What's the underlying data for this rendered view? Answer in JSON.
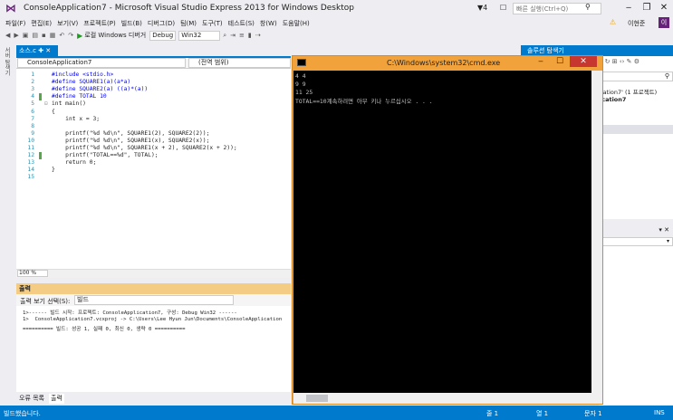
{
  "window": {
    "title": "ConsoleApplication7 - Microsoft Visual Studio Express 2013 for Windows Desktop",
    "notification_count": "4",
    "quick_launch_placeholder": "빠른 실행(Ctrl+Q)",
    "user": "이현준",
    "user_initials": "이"
  },
  "menu": [
    "파일(F)",
    "편집(E)",
    "보기(V)",
    "프로젝트(P)",
    "빌드(B)",
    "디버그(D)",
    "팀(M)",
    "도구(T)",
    "테스트(S)",
    "창(W)",
    "도움말(H)"
  ],
  "toolbar": {
    "run_label": "로컬 Windows 디버거",
    "config": "Debug",
    "platform": "Win32"
  },
  "side_tab": "서버 탐색기",
  "editor": {
    "tab_label": "소스.c",
    "project_combo": "ConsoleApplication7",
    "scope_combo": "(전역 범위)",
    "zoom": "100 %",
    "lines": [
      {
        "n": "1",
        "code": "#include <stdio.h>"
      },
      {
        "n": "2",
        "code": "#define SQUARE1(a)(a*a)"
      },
      {
        "n": "3",
        "code": "#define SQUARE2(a) ((a)*(a))"
      },
      {
        "n": "4",
        "code": "#define TOTAL 10"
      },
      {
        "n": "5",
        "code": "int main()"
      },
      {
        "n": "6",
        "code": "{"
      },
      {
        "n": "7",
        "code": "    int x = 3;"
      },
      {
        "n": "8",
        "code": ""
      },
      {
        "n": "9",
        "code": "    printf(\"%d %d\\n\", SQUARE1(2), SQUARE2(2));"
      },
      {
        "n": "10",
        "code": "    printf(\"%d %d\\n\", SQUARE1(x), SQUARE2(x));"
      },
      {
        "n": "11",
        "code": "    printf(\"%d %d\\n\", SQUARE1(x + 2), SQUARE2(x + 2));"
      },
      {
        "n": "12",
        "code": "    printf(\"TOTAL==%d\", TOTAL);"
      },
      {
        "n": "13",
        "code": "    return 0;"
      },
      {
        "n": "14",
        "code": "}"
      },
      {
        "n": "15",
        "code": ""
      }
    ]
  },
  "output": {
    "header": "출력",
    "source_label": "출력 보기 선택(S):",
    "source_value": "빌드",
    "lines": [
      "1>------ 빌드 시작: 프로젝트: ConsoleApplication7, 구성: Debug Win32 ------",
      "1>  ConsoleApplication7.vcxproj -> C:\\Users\\Lee Hyun Jun\\Documents\\ConsoleApplication",
      "========== 빌드: 성공 1, 실패 0, 최신 0, 생략 0 =========="
    ],
    "tabs": [
      "오류 목록",
      "출력"
    ]
  },
  "console": {
    "title": "C:\\Windows\\system32\\cmd.exe",
    "lines": [
      "4 4",
      "9 9",
      "11 25",
      "TOTAL==10계속하려면 아무 키나 누르십시오 . . ."
    ]
  },
  "solution_explorer": {
    "title": "솔루션 탐색기",
    "solution_item": "cation7' (1 프로젝트)",
    "project_item": "ication7"
  },
  "status": {
    "message": "빌드했습니다.",
    "line": "줄 1",
    "col": "열 1",
    "char": "문자 1",
    "mode": "INS"
  },
  "colors": {
    "accent": "#007acc",
    "console_frame": "#f2a23b",
    "output_header": "#f5cc84",
    "vs_purple": "#68217a"
  }
}
